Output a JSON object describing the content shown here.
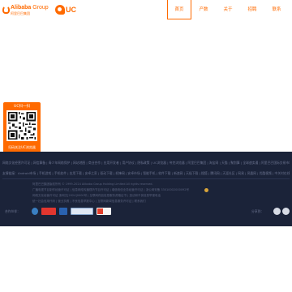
{
  "header": {
    "logo_brand": "Alibaba",
    "logo_group": "Group",
    "logo_sub": "阿里巴巴集团",
    "uc_logo": "UC",
    "nav": [
      {
        "label": "首页",
        "active": true
      },
      {
        "label": "产数",
        "active": false
      },
      {
        "label": "关于",
        "active": false
      },
      {
        "label": "招聘",
        "active": false
      },
      {
        "label": "联系",
        "active": false
      }
    ]
  },
  "qr_card": {
    "title": "UC扫一扫",
    "caption": "扫码关注UC浏览器"
  },
  "footer": {
    "links_row1": "网络文化经营许可证 | 网信算备 | 青少年网络保护 | 网站地图 | 商业合作 | 应用开发者 | 用户协议 | 隐私政策 | UC浏览器 | 夸克浏览器 | 阿里巴巴集团 | 淘宝网 | 天猫 | 聚划算 | 全球速卖通 | 阿里巴巴国际交易市场 | 1688 | 阿里妈妈 | 飞猪 | 阿里云计算 | AliOS | 万网 | 高德 | 优酷 | 钉钉 | 支付宝",
    "links_row2": "友情链接：Android市场 | 手机游戏 | 手机软件 | 应用下载 | 安卓之家 | 驱动下载 | 机锋网 | 安卓市场 | 智能手机 | 软件下载 | 新浪网 | 天极下载 | 搜狐 | 腾讯网 | 天涯社区 | 网易 | 凤凰网 | 优酷视频 | 中关村在线 | 站长之家 | 太平洋电脑网 | 更多",
    "info_line1": "阿里巴巴集团版权所有 © 1999-2024 Alibaba Group Holding Limited All rights reserved.",
    "info_line2": "广播电视节目制作经营许可证 | 信息网络传播视听节目许可证 | 增值电信业务经营许可证 | 浙公网安备 33010002000092号",
    "info_line3": "网络文化经营许可证 浙网文[2024]0000号 | 互联网药品信息服务资格证书 | 违法和不良信息举报电话",
    "info_line4": "统一社会信用代码 | 营业执照 | 不良信息举报中心 | 互联网新闻信息服务许可证 | 联系我们",
    "partners_label": "合作伙伴：",
    "share_label": "分享到："
  }
}
